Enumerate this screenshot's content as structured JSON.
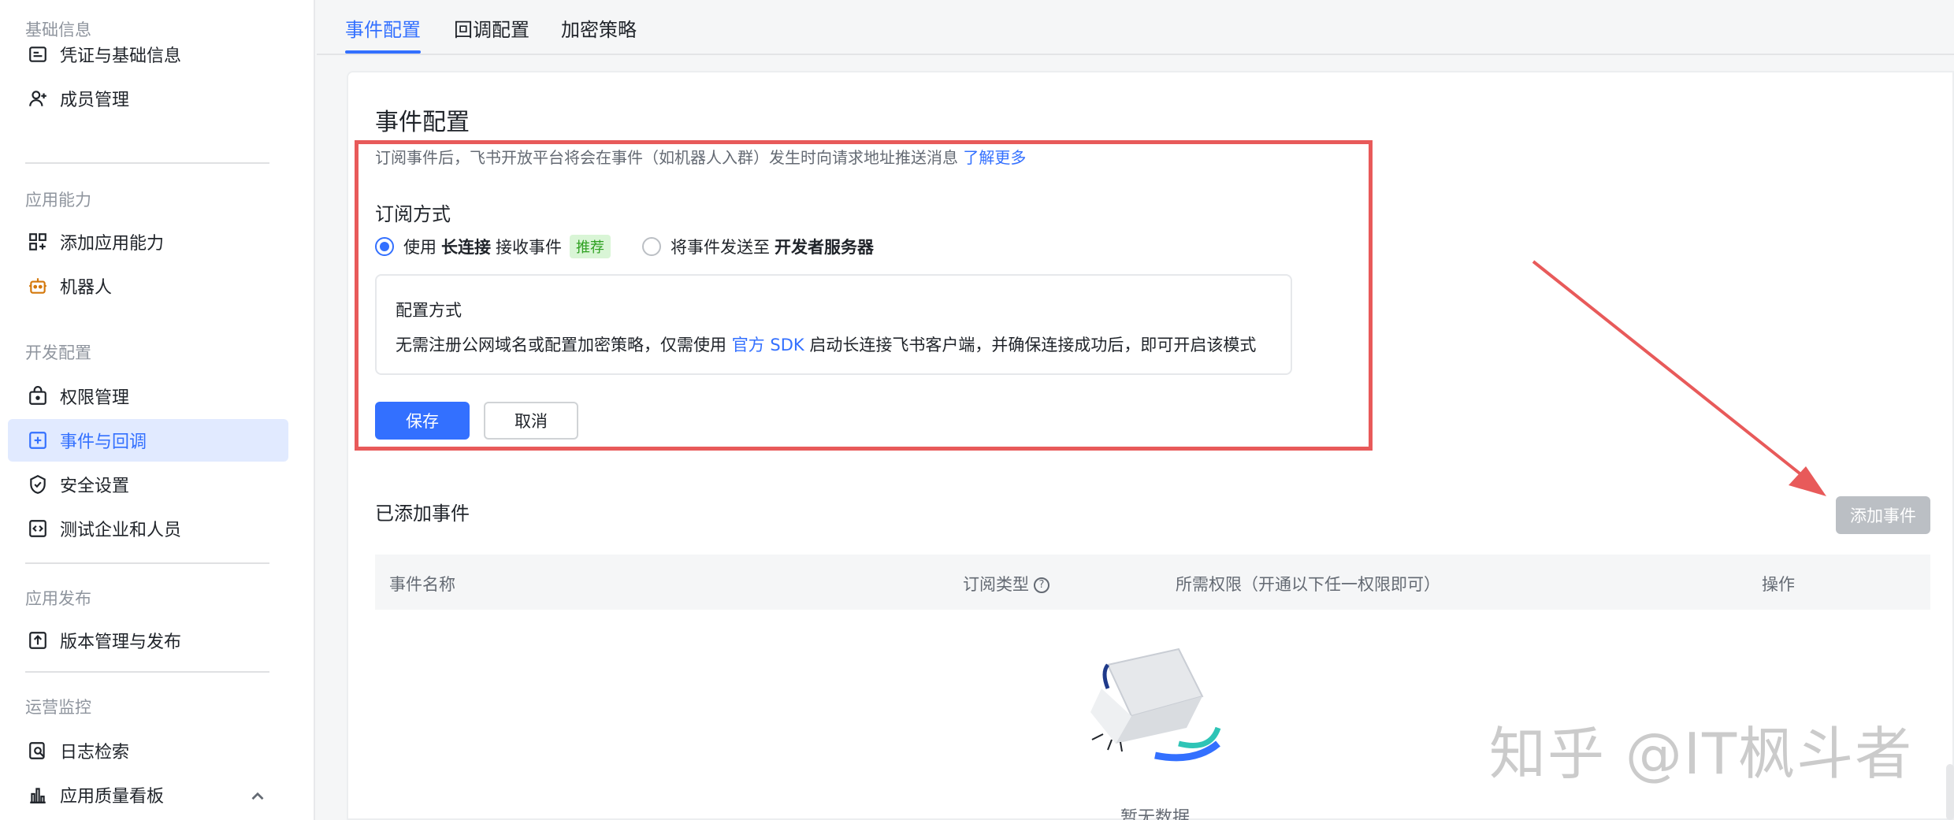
{
  "sidebar": {
    "groups": [
      {
        "title": "基础信息",
        "items": [
          {
            "label": "凭证与基础信息",
            "icon": "credential-icon"
          },
          {
            "label": "成员管理",
            "icon": "member-add-icon"
          }
        ]
      },
      {
        "title": "应用能力",
        "items": [
          {
            "label": "添加应用能力",
            "icon": "add-ability-icon"
          },
          {
            "label": "机器人",
            "icon": "robot-icon"
          }
        ]
      },
      {
        "title": "开发配置",
        "items": [
          {
            "label": "权限管理",
            "icon": "permission-icon"
          },
          {
            "label": "事件与回调",
            "icon": "event-icon",
            "active": true
          },
          {
            "label": "安全设置",
            "icon": "shield-icon"
          },
          {
            "label": "测试企业和人员",
            "icon": "code-icon"
          }
        ]
      },
      {
        "title": "应用发布",
        "items": [
          {
            "label": "版本管理与发布",
            "icon": "upload-icon"
          }
        ]
      },
      {
        "title": "运营监控",
        "items": [
          {
            "label": "日志检索",
            "icon": "log-search-icon"
          },
          {
            "label": "应用质量看板",
            "icon": "chart-icon"
          }
        ]
      }
    ]
  },
  "tabs": [
    {
      "label": "事件配置",
      "active": true
    },
    {
      "label": "回调配置"
    },
    {
      "label": "加密策略"
    }
  ],
  "event_config": {
    "title": "事件配置",
    "description": "订阅事件后，飞书开放平台将会在事件（如机器人入群）发生时向请求地址推送消息",
    "learn_more": "了解更多",
    "subscribe_title": "订阅方式",
    "option1": {
      "prefix": "使用",
      "bold": "长连接",
      "suffix": "接收事件",
      "tag": "推荐",
      "checked": true
    },
    "option2": {
      "prefix": "将事件发送至",
      "bold": "开发者服务器",
      "checked": false
    },
    "config_box": {
      "title": "配置方式",
      "text_before": "无需注册公网域名或配置加密策略，仅需使用",
      "link": "官方 SDK",
      "text_after": "启动长连接飞书客户端，并确保连接成功后，即可开启该模式"
    },
    "save": "保存",
    "cancel": "取消"
  },
  "added_events": {
    "title": "已添加事件",
    "add_button": "添加事件",
    "columns": [
      "事件名称",
      "订阅类型",
      "所需权限（开通以下任一权限即可）",
      "操作"
    ],
    "empty_text": "暂无数据"
  },
  "watermark": "知乎 @IT枫斗者",
  "colors": {
    "accent": "#3370ff",
    "highlight": "#e85a5a",
    "sidebar_active_bg": "#e1eaff"
  }
}
